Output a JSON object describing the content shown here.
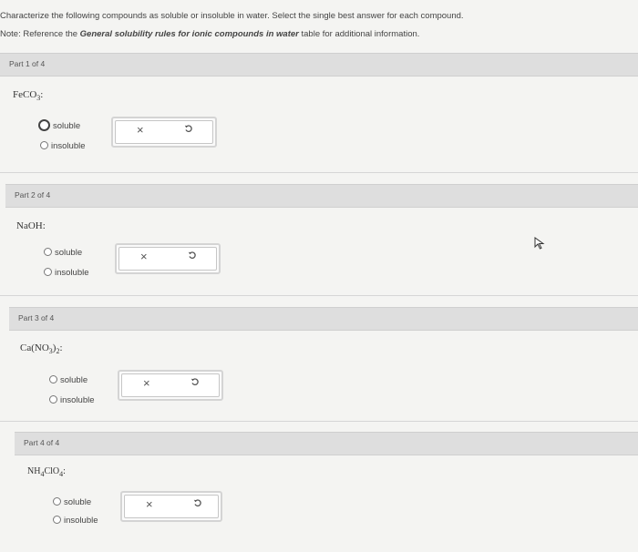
{
  "instructions": {
    "line1": "Characterize the following compounds as soluble or insoluble in water. Select the single best answer for each compound.",
    "note_prefix": "Note: Reference the ",
    "note_bold": "General solubility rules for ionic compounds in water",
    "note_suffix": " table for additional information."
  },
  "parts": [
    {
      "header": "Part 1 of 4",
      "compound_main": "FeCO",
      "compound_sub": "3",
      "compound_tail": ":",
      "options": [
        "soluble",
        "insoluble"
      ]
    },
    {
      "header": "Part 2 of 4",
      "compound_main": "NaOH",
      "compound_tail": ":",
      "options": [
        "soluble",
        "insoluble"
      ]
    },
    {
      "header": "Part 3 of 4",
      "compound_main": "Ca(NO",
      "compound_sub": "3",
      "compound_mid": ")",
      "compound_sub2": "2",
      "compound_tail": ":",
      "options": [
        "soluble",
        "insoluble"
      ]
    },
    {
      "header": "Part 4 of 4",
      "compound_main": "NH",
      "compound_sub": "4",
      "compound_mid": "ClO",
      "compound_sub2": "4",
      "compound_tail": ":",
      "options": [
        "soluble",
        "insoluble"
      ]
    }
  ],
  "buttons": {
    "clear_symbol": "×",
    "undo_icon": "undo-icon"
  }
}
